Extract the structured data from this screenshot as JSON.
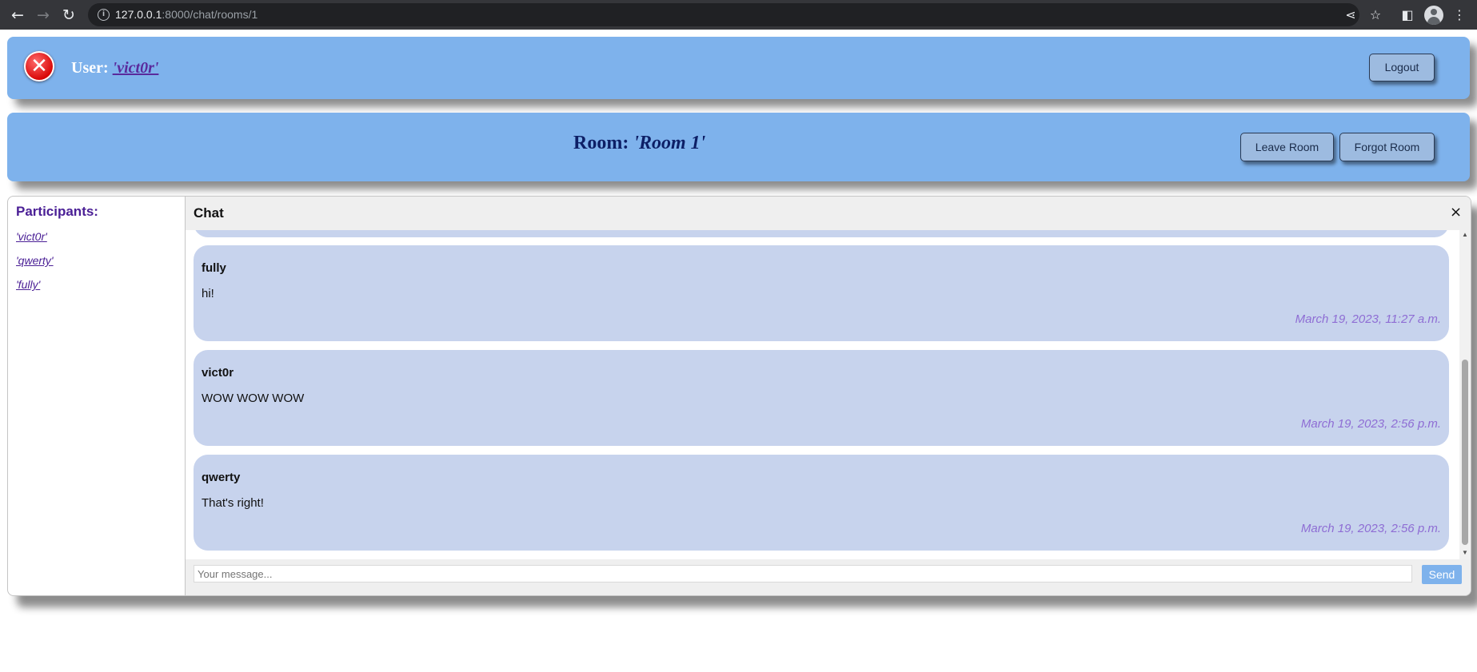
{
  "browser": {
    "url_host": "127.0.0.1",
    "url_path": ":8000/chat/rooms/1",
    "icons": [
      "back-icon",
      "forward-icon",
      "reload-icon",
      "info-icon",
      "share-icon",
      "star-icon",
      "side-panel-icon",
      "profile-icon",
      "kebab-menu-icon"
    ]
  },
  "user_panel": {
    "label": "User: ",
    "username": "'vict0r'",
    "logout_label": "Logout",
    "status_icon": "error-x-icon"
  },
  "room_panel": {
    "label": "Room: ",
    "room_name": "'Room 1'",
    "leave_label": "Leave Room",
    "forgot_label": "Forgot Room"
  },
  "participants": {
    "title": "Participants:",
    "items": [
      "'vict0r'",
      "'qwerty'",
      "'fully'"
    ]
  },
  "chat": {
    "title": "Chat",
    "close_label": "×",
    "messages": [
      {
        "sender": "fully",
        "text": "hi!",
        "time": "March 19, 2023, 11:27 a.m."
      },
      {
        "sender": "vict0r",
        "text": "WOW WOW WOW",
        "time": "March 19, 2023, 2:56 p.m."
      },
      {
        "sender": "qwerty",
        "text": "That's right!",
        "time": "March 19, 2023, 2:56 p.m."
      }
    ],
    "input_placeholder": "Your message...",
    "input_value": "",
    "send_label": "Send"
  },
  "colors": {
    "panel": "#7eb2ec",
    "message_bubble": "#c7d3ed",
    "timestamp": "#8e6dd4",
    "link": "#4b2096"
  }
}
